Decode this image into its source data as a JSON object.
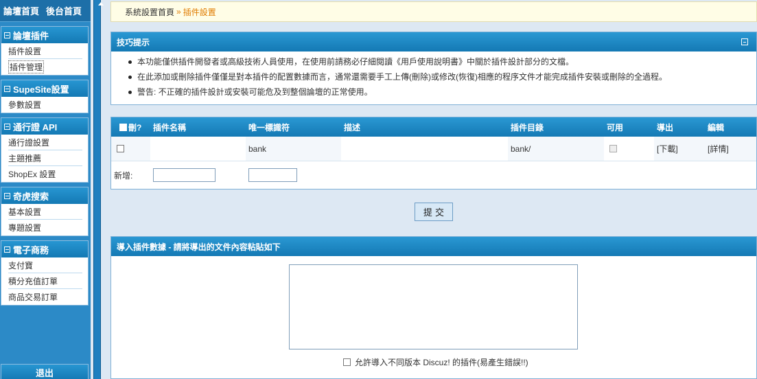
{
  "topbar": {
    "forum_home": "論壇首頁",
    "admin_home": "後台首頁"
  },
  "sidebar": {
    "menus": [
      {
        "title": "論壇插件",
        "items": [
          "插件設置",
          "插件管理"
        ]
      },
      {
        "title": "SupeSite設置",
        "items": [
          "參數設置"
        ]
      },
      {
        "title": "通行證 API",
        "items": [
          "通行證設置",
          "主題推薦",
          "ShopEx 設置"
        ]
      },
      {
        "title": "奇虎搜索",
        "items": [
          "基本設置",
          "專題設置"
        ]
      },
      {
        "title": "電子商務",
        "items": [
          "支付寶",
          "積分充值訂單",
          "商品交易訂單"
        ]
      }
    ],
    "logout": "退出"
  },
  "breadcrumb": {
    "home": "系統設置首頁",
    "separator": "»",
    "current": "插件設置"
  },
  "tips": {
    "title": "技巧提示",
    "items": [
      "本功能僅供插件開發者或高級技術人員使用，在使用前請務必仔細閱讀《用戶使用說明書》中關於插件設計部分的文檔。",
      "在此添加或刪除插件僅僅是對本插件的配置數據而言，通常還需要手工上傳(刪除)或修改(恢復)相應的程序文件才能完成插件安裝或刪除的全過程。",
      "警告: 不正確的插件設計或安裝可能危及到整個論壇的正常使用。"
    ]
  },
  "plugins_table": {
    "headers": [
      "刪?",
      "插件名稱",
      "唯一標識符",
      "描述",
      "插件目錄",
      "可用",
      "導出",
      "編輯"
    ],
    "rows": [
      {
        "name": "",
        "identifier": "bank",
        "description": "",
        "directory": "bank/",
        "export": "[下載]",
        "edit": "[詳情]"
      }
    ],
    "new_label": "新增:"
  },
  "submit_label": "提 交",
  "import": {
    "title": "導入插件數據 - 請將導出的文件內容粘貼如下",
    "allow_label": "允許導入不同版本 Discuz! 的插件(易產生錯誤!!)"
  }
}
